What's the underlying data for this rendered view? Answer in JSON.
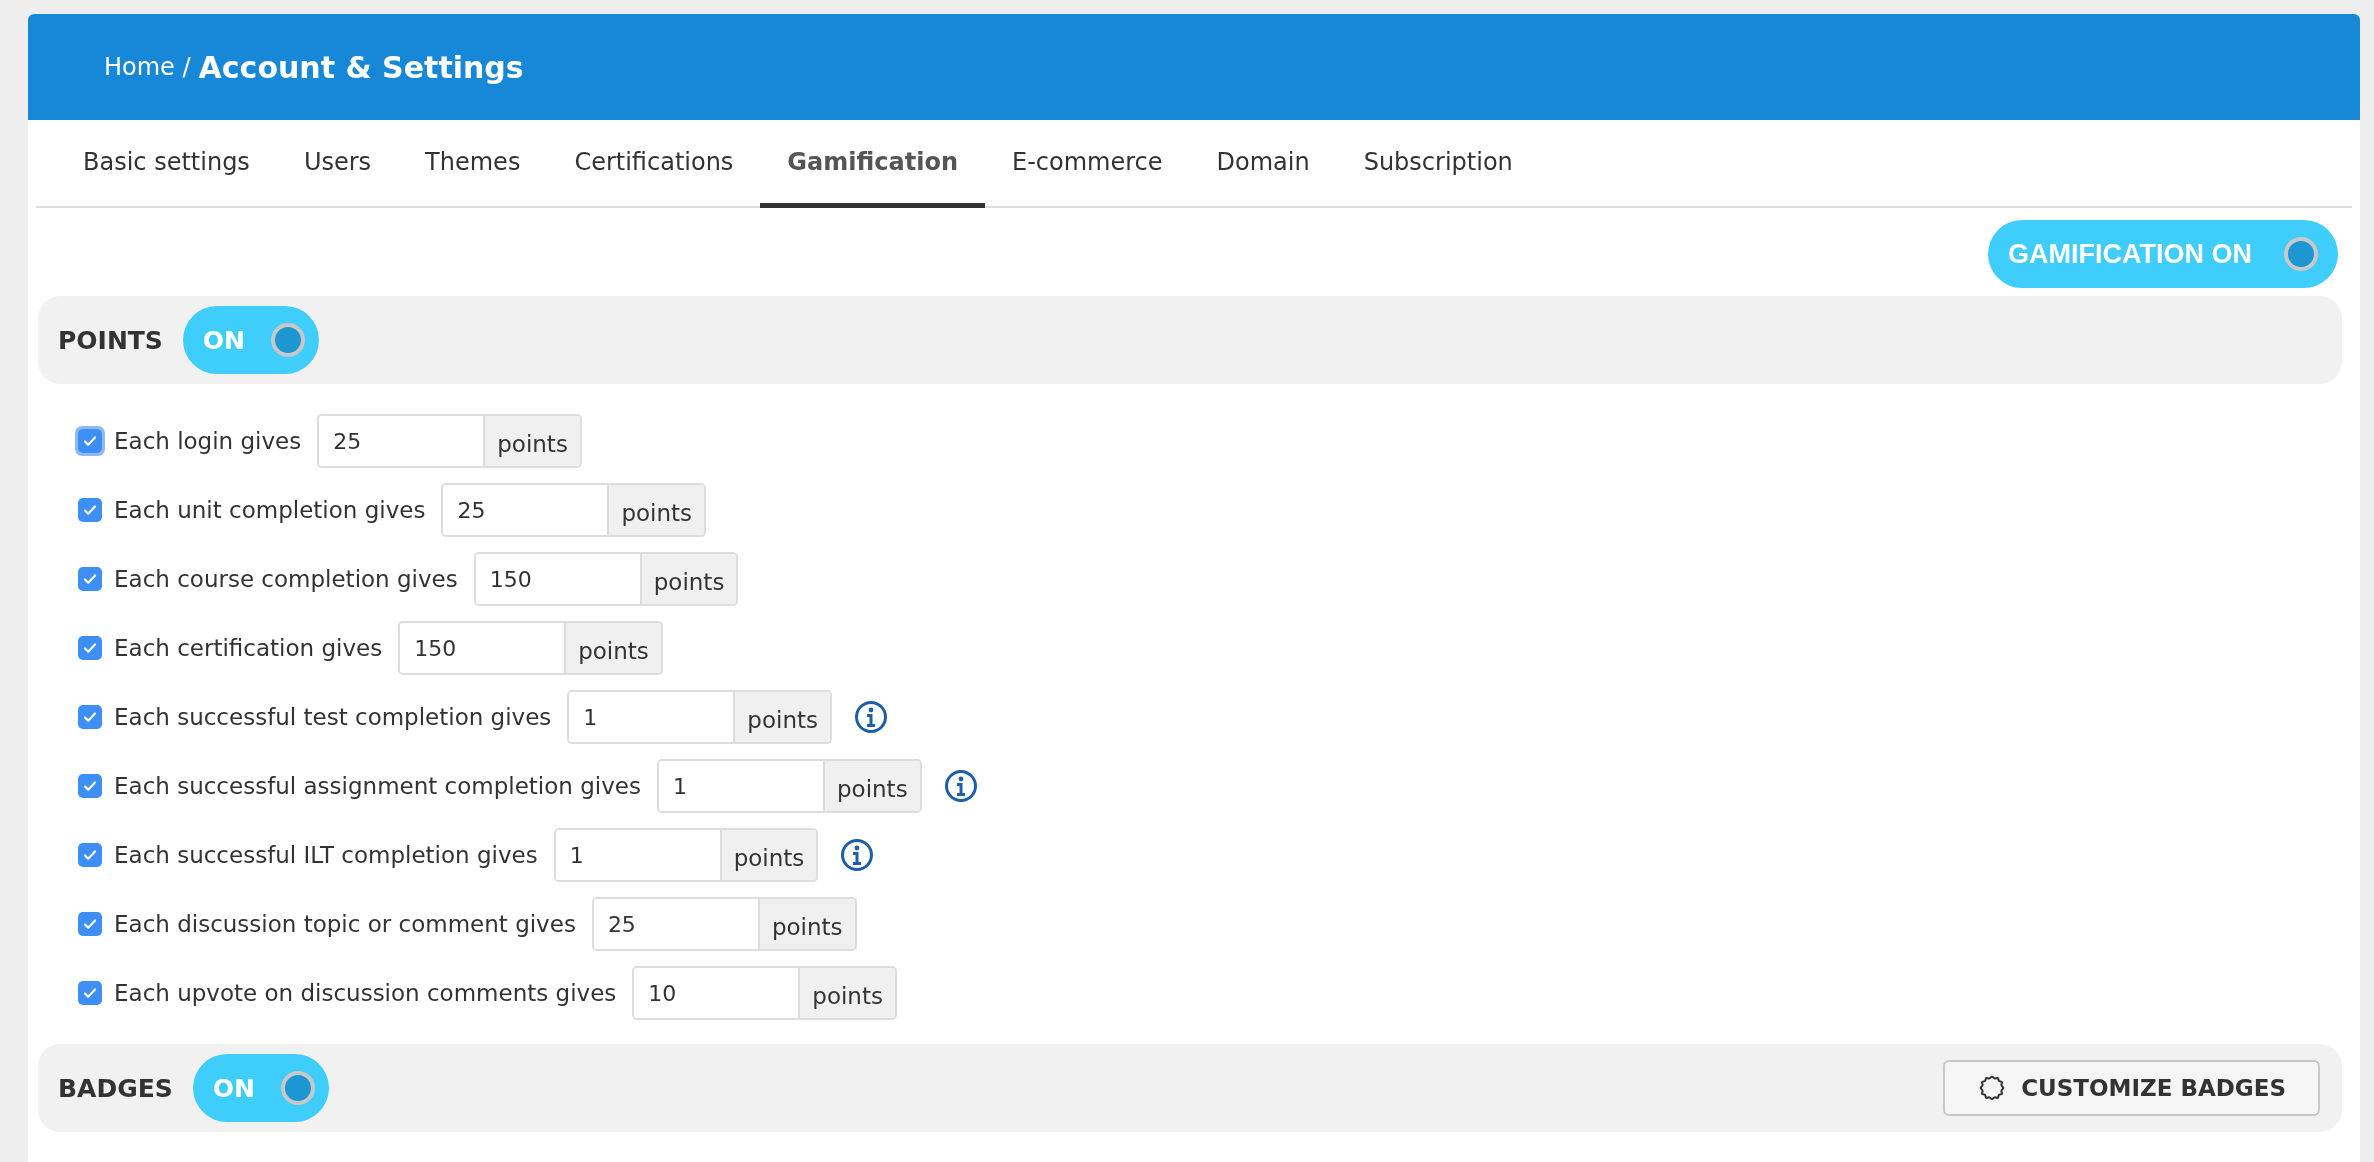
{
  "header": {
    "breadcrumb_home": "Home /",
    "title": "Account & Settings"
  },
  "tabs": [
    {
      "label": "Basic settings",
      "selected": false
    },
    {
      "label": "Users",
      "selected": false
    },
    {
      "label": "Themes",
      "selected": false
    },
    {
      "label": "Certifications",
      "selected": false
    },
    {
      "label": "Gamification",
      "selected": true
    },
    {
      "label": "E-commerce",
      "selected": false
    },
    {
      "label": "Domain",
      "selected": false
    },
    {
      "label": "Subscription",
      "selected": false
    }
  ],
  "master_toggle": {
    "label": "GAMIFICATION ON",
    "on": true
  },
  "points": {
    "title": "POINTS",
    "toggle": {
      "label": "ON",
      "on": true
    },
    "rules": [
      {
        "label": "Each login gives",
        "value": "25",
        "unit": "points",
        "checked": true,
        "focused": true,
        "info": false
      },
      {
        "label": "Each unit completion gives",
        "value": "25",
        "unit": "points",
        "checked": true,
        "focused": false,
        "info": false
      },
      {
        "label": "Each course completion gives",
        "value": "150",
        "unit": "points",
        "checked": true,
        "focused": false,
        "info": false
      },
      {
        "label": "Each certification gives",
        "value": "150",
        "unit": "points",
        "checked": true,
        "focused": false,
        "info": false
      },
      {
        "label": "Each successful test completion gives",
        "value": "1",
        "unit": "points",
        "checked": true,
        "focused": false,
        "info": true
      },
      {
        "label": "Each successful assignment completion gives",
        "value": "1",
        "unit": "points",
        "checked": true,
        "focused": false,
        "info": true
      },
      {
        "label": "Each successful ILT completion gives",
        "value": "1",
        "unit": "points",
        "checked": true,
        "focused": false,
        "info": true
      },
      {
        "label": "Each discussion topic or comment gives",
        "value": "25",
        "unit": "points",
        "checked": true,
        "focused": false,
        "info": false
      },
      {
        "label": "Each upvote on discussion comments gives",
        "value": "10",
        "unit": "points",
        "checked": true,
        "focused": false,
        "info": false
      }
    ]
  },
  "badges": {
    "title": "BADGES",
    "toggle": {
      "label": "ON",
      "on": true
    },
    "button": "CUSTOMIZE BADGES"
  }
}
